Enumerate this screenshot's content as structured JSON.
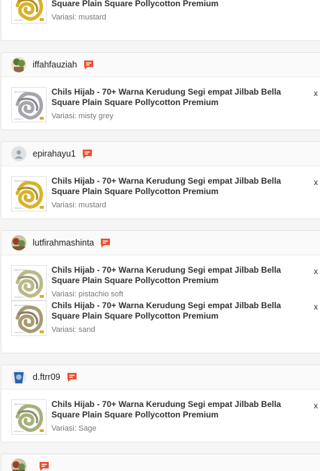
{
  "product_name": "Chils Hijab - 70+ Warna Kerudung Segi empat Jilbab Bella Square Plain Square Pollycotton Premium",
  "quantity_prefix": "x",
  "orders": [
    {
      "username": "",
      "avatar": "none",
      "items": [
        {
          "variation": "Variasi: mustard",
          "color": "#d9b12c"
        }
      ]
    },
    {
      "username": "iffahfauziah",
      "avatar": "photo-green",
      "items": [
        {
          "variation": "Variasi: misty grey",
          "color": "#a6a4ad"
        }
      ]
    },
    {
      "username": "epirahayu1",
      "avatar": "default-person",
      "items": [
        {
          "variation": "Variasi: mustard",
          "color": "#d9b12c"
        }
      ]
    },
    {
      "username": "lutfirahmashinta",
      "avatar": "photo-red",
      "items": [
        {
          "variation": "Variasi: pistachio soft",
          "color": "#b9b98a"
        },
        {
          "variation": "Variasi: sand",
          "color": "#a89a72"
        }
      ]
    },
    {
      "username": "d.ftrr09",
      "avatar": "photo-blue",
      "items": [
        {
          "variation": "Variasi: Sage",
          "color": "#a7b07c"
        }
      ]
    },
    {
      "username": "",
      "avatar": "photo-red",
      "items": []
    }
  ]
}
